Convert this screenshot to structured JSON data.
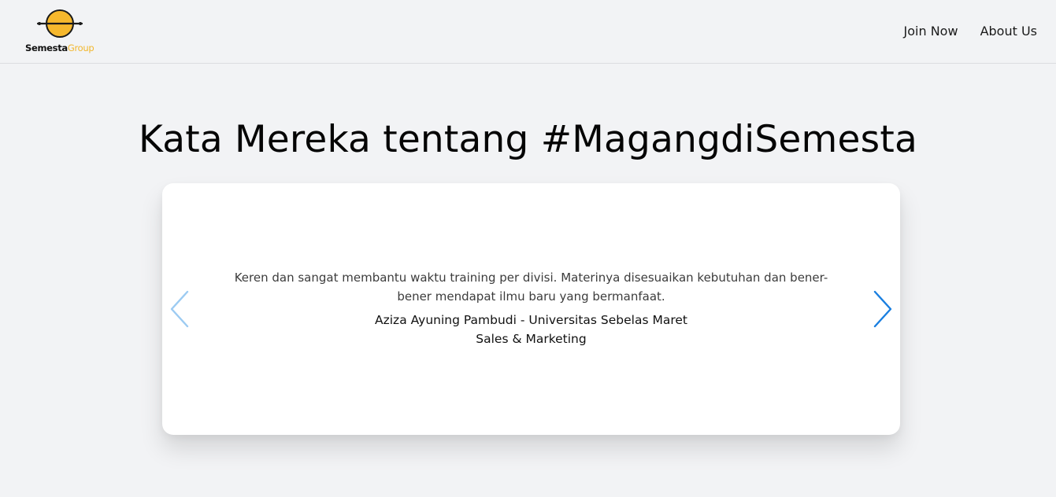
{
  "brand": {
    "word1": "Semesta",
    "word2": "Group",
    "colors": {
      "accent": "#f6b82d",
      "dark": "#111111"
    }
  },
  "nav": {
    "items": [
      {
        "label": "Join Now"
      },
      {
        "label": "About Us"
      }
    ]
  },
  "main": {
    "title": "Kata Mereka tentang #MagangdiSemesta"
  },
  "testimonial": {
    "quote": "Keren dan sangat membantu waktu training per divisi. Materinya disesuaikan kebutuhan dan bener-bener mendapat ilmu baru yang bermanfaat.",
    "author": "Aziza Ayuning Pambudi - Universitas Sebelas Maret",
    "division": "Sales & Marketing"
  },
  "carousel": {
    "prev_icon": "chevron-left-icon",
    "next_icon": "chevron-right-icon",
    "colors": {
      "prev": "#9ccbf2",
      "next": "#1a7fe0"
    }
  }
}
